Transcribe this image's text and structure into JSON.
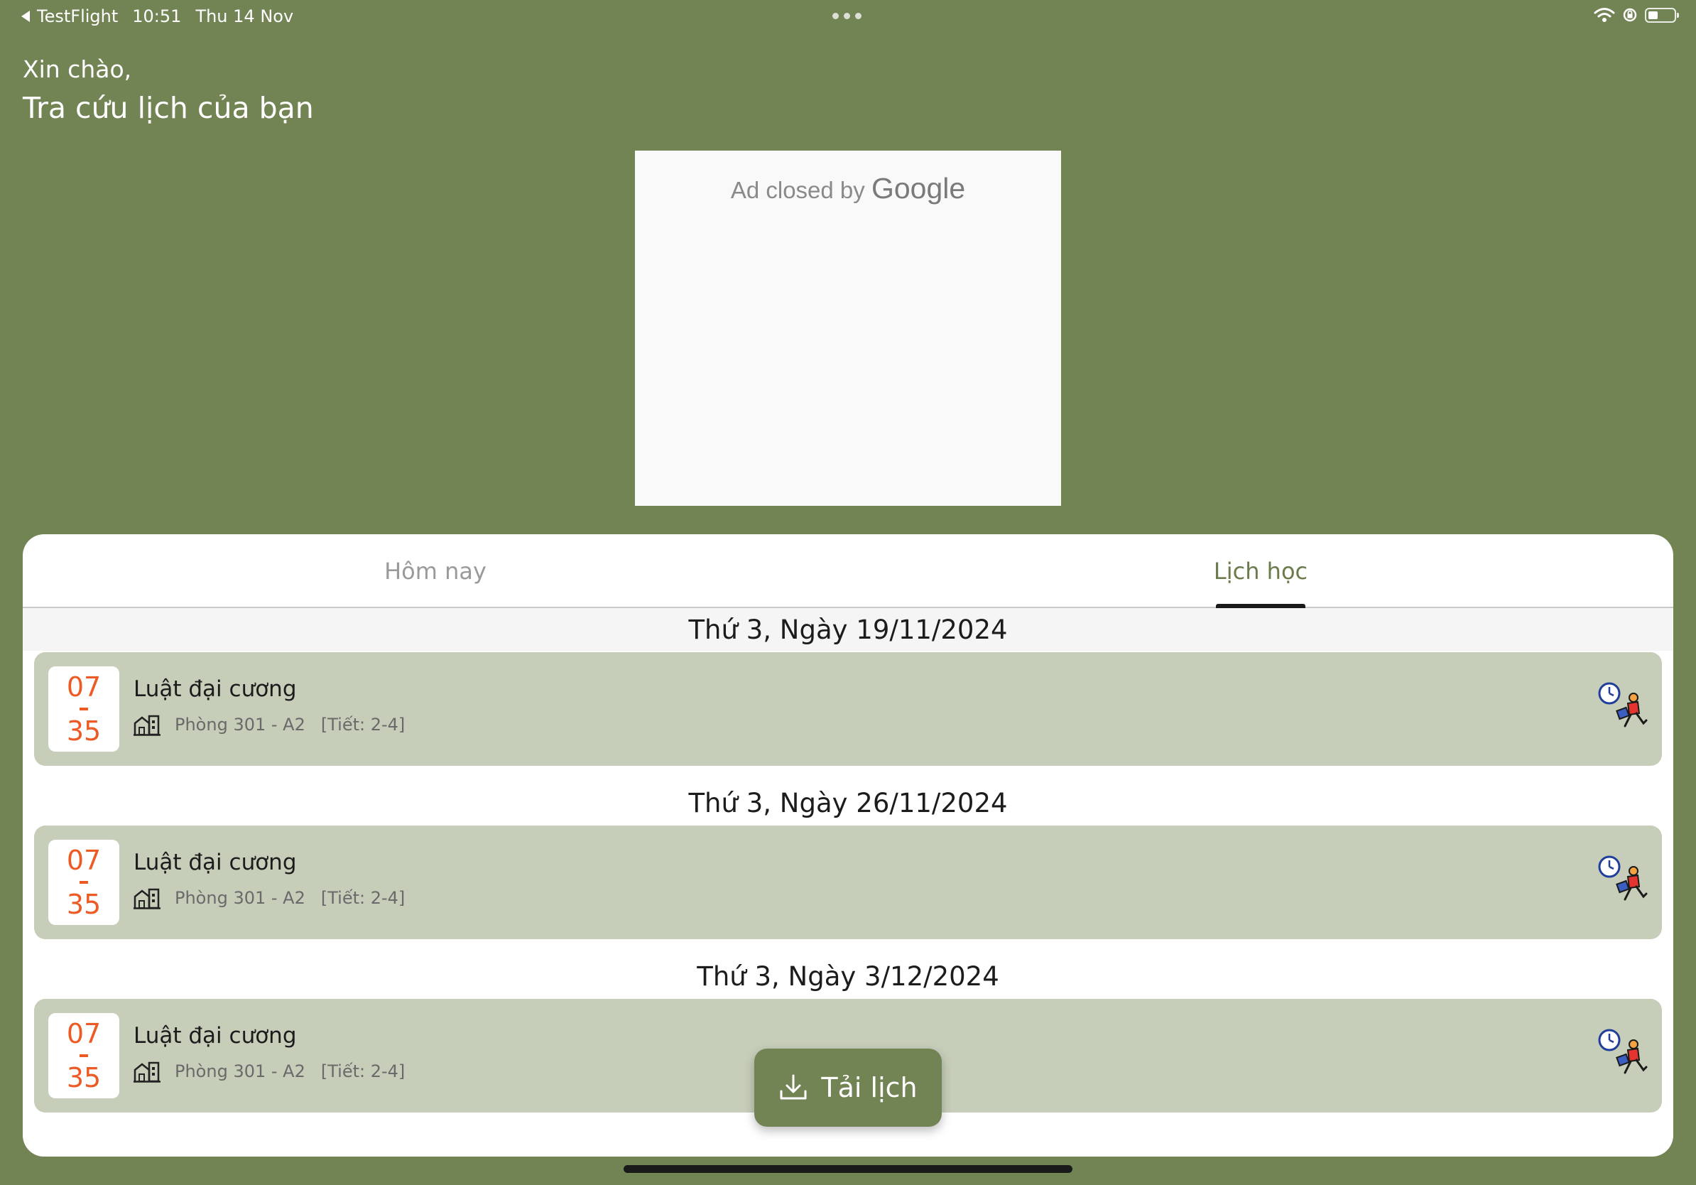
{
  "status_bar": {
    "back_app": "TestFlight",
    "time": "10:51",
    "date": "Thu 14 Nov"
  },
  "header": {
    "greeting": "Xin chào,",
    "title": "Tra cứu lịch của bạn"
  },
  "ad": {
    "text": "Ad closed by",
    "brand": "Google"
  },
  "tabs": [
    {
      "label": "Hôm nay",
      "selected": false
    },
    {
      "label": "Lịch học",
      "selected": true
    }
  ],
  "schedule": [
    {
      "date": "Thứ 3, Ngày 19/11/2024",
      "classes": [
        {
          "start": "07",
          "end": "35",
          "subject": "Luật đại cương",
          "room": "Phòng 301 - A2",
          "periods": "[Tiết: 2-4]"
        }
      ]
    },
    {
      "date": "Thứ 3, Ngày 26/11/2024",
      "classes": [
        {
          "start": "07",
          "end": "35",
          "subject": "Luật đại cương",
          "room": "Phòng 301 - A2",
          "periods": "[Tiết: 2-4]"
        }
      ]
    },
    {
      "date": "Thứ 3, Ngày 3/12/2024",
      "classes": [
        {
          "start": "07",
          "end": "35",
          "subject": "Luật đại cương",
          "room": "Phòng 301 - A2",
          "periods": "[Tiết: 2-4]"
        }
      ]
    }
  ],
  "download_button": {
    "label": "Tải lịch",
    "icon": "download-icon"
  },
  "icons": {
    "room": "building-icon",
    "status": "late-runner-clock-icon"
  },
  "colors": {
    "background": "#738454",
    "accent": "#6b7b4c",
    "time_text": "#ee5a24",
    "item_background": "#c6cdb9"
  }
}
